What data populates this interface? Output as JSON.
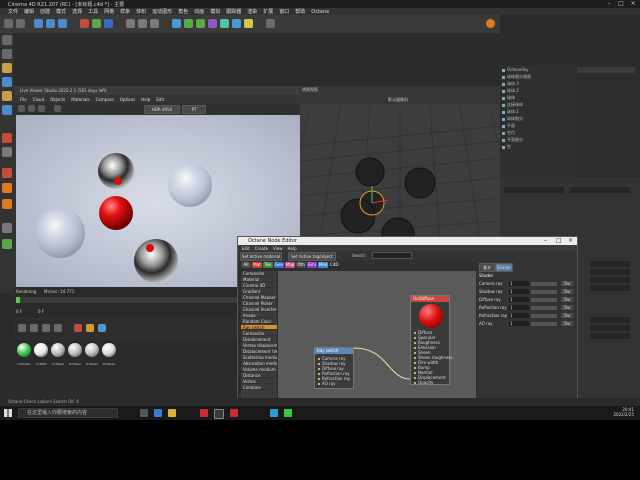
{
  "app": {
    "title": "Cinema 4D R21.207 (RC) - [未标题.c4d *] - 主要",
    "menu": [
      "文件",
      "编辑",
      "创建",
      "模式",
      "选择",
      "工具",
      "网格",
      "样条",
      "体积",
      "运动图形",
      "角色",
      "动画",
      "模拟",
      "跟踪器",
      "渲染",
      "扩展",
      "窗口",
      "帮助",
      "Octane"
    ]
  },
  "live_viewer": {
    "title": "Live Viewer Studio 2020.2.1 (561 days left)",
    "menu": [
      "File",
      "Cloud",
      "Objects",
      "Materials",
      "Compare",
      "Options",
      "Help",
      "Edit"
    ],
    "mode": "HDR 4950",
    "mode2": "PT"
  },
  "right_viewport": {
    "label": "透视视图",
    "camera": "默认摄像机"
  },
  "objects": [
    "OctaneSky",
    "球体细分曲面",
    "球体.3",
    "球体.2",
    "球体",
    "连接球体",
    "球体.1",
    "球体细分",
    "平面",
    "空白",
    "平面细分",
    "空"
  ],
  "timeline": {
    "status": "Rendering",
    "label": "Ms/sec: 24.771",
    "frame": "0 F",
    "frame2": "0 F"
  },
  "materials": [
    "OctGlass",
    "OctDiff",
    "OctSpec",
    "OctSpec",
    "OctSpec",
    "OctSpec"
  ],
  "node_editor": {
    "title": "Octane Node Editor",
    "menu": [
      "Edit",
      "Create",
      "View",
      "Help"
    ],
    "btn_material": "Set Active material",
    "btn_tag": "Set Active tag/object",
    "search_label": "Search",
    "tags": [
      "All",
      "Mat",
      "Tex",
      "Gen",
      "Map",
      "Oth",
      "Emi",
      "Med",
      "C4D"
    ],
    "nodelist": [
      "Composite",
      "Material",
      "Cinema 4D",
      "Gradient",
      "Channel Mapper",
      "Channel Picker",
      "Channel Inverter",
      "Image",
      "Random Color",
      "Ray switch",
      "Composite",
      "Displacement",
      "Vertex displacement",
      "Displacement (Vector)",
      "Scattering medium",
      "Absorption medium",
      "Volume medium",
      "Distance",
      "Vertex",
      "Combine"
    ],
    "node_ray": {
      "name": "Ray switch",
      "ports": [
        "Camera ray",
        "Shadow ray",
        "Diffuse ray",
        "Reflection ray",
        "Refraction ray",
        "AO ray"
      ]
    },
    "node_mat": {
      "name": "OctDiffuse",
      "ports": [
        "Diffuse",
        "Specular",
        "Roughness",
        "Emission",
        "Sheen",
        "Sheen roughness",
        "Film width",
        "Bump",
        "Normal",
        "Displacement",
        "Opacity"
      ]
    },
    "shader_tabs": [
      "基本",
      "Shader"
    ],
    "shader_title": "Shader",
    "shader_rows": [
      {
        "label": "Camera ray",
        "value": "1",
        "btn": "Tex"
      },
      {
        "label": "Shadow ray",
        "value": "1",
        "btn": "Tex"
      },
      {
        "label": "Diffuse ray",
        "value": "1",
        "btn": "Tex"
      },
      {
        "label": "Reflection ray",
        "value": "1",
        "btn": "Tex"
      },
      {
        "label": "Refraction ray",
        "value": "1",
        "btn": "Tex"
      },
      {
        "label": "AO ray",
        "value": "1",
        "btn": "Tex"
      }
    ]
  },
  "status_bar": "Octane:Check calbers Search OK: 6",
  "taskbar": {
    "search_placeholder": "在这里输入你要搜索的内容",
    "time": "20:41",
    "date": "2022/2/25"
  }
}
